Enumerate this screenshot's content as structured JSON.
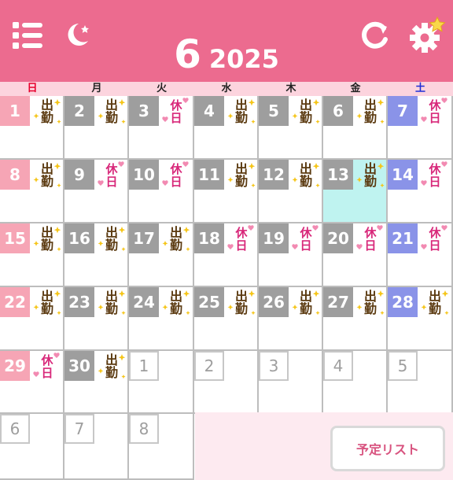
{
  "header": {
    "month": "6",
    "year": "2025",
    "icons": [
      "menu-icon",
      "moon-icon",
      "reload-icon",
      "gear-icon"
    ],
    "background": "#ec6b8f"
  },
  "weekdays": [
    "日",
    "月",
    "火",
    "水",
    "木",
    "金",
    "土"
  ],
  "weekday_colors": [
    "#e6002d",
    "#222222",
    "#222222",
    "#222222",
    "#222222",
    "#222222",
    "#1f2fd6"
  ],
  "stamps": {
    "work": "出勤",
    "off": "休日"
  },
  "weeks": [
    [
      {
        "d": "1",
        "s": "work"
      },
      {
        "d": "2",
        "s": "work"
      },
      {
        "d": "3",
        "s": "off"
      },
      {
        "d": "4",
        "s": "work"
      },
      {
        "d": "5",
        "s": "work"
      },
      {
        "d": "6",
        "s": "work"
      },
      {
        "d": "7",
        "s": "off"
      }
    ],
    [
      {
        "d": "8",
        "s": "work"
      },
      {
        "d": "9",
        "s": "off"
      },
      {
        "d": "10",
        "s": "off"
      },
      {
        "d": "11",
        "s": "work"
      },
      {
        "d": "12",
        "s": "work"
      },
      {
        "d": "13",
        "s": "work",
        "today": true
      },
      {
        "d": "14",
        "s": "off"
      }
    ],
    [
      {
        "d": "15",
        "s": "work"
      },
      {
        "d": "16",
        "s": "work"
      },
      {
        "d": "17",
        "s": "work"
      },
      {
        "d": "18",
        "s": "off"
      },
      {
        "d": "19",
        "s": "off"
      },
      {
        "d": "20",
        "s": "off"
      },
      {
        "d": "21",
        "s": "off"
      }
    ],
    [
      {
        "d": "22",
        "s": "work"
      },
      {
        "d": "23",
        "s": "work"
      },
      {
        "d": "24",
        "s": "work"
      },
      {
        "d": "25",
        "s": "work"
      },
      {
        "d": "26",
        "s": "work"
      },
      {
        "d": "27",
        "s": "work"
      },
      {
        "d": "28",
        "s": "work"
      }
    ],
    [
      {
        "d": "29",
        "s": "off"
      },
      {
        "d": "30",
        "s": "work"
      },
      {
        "d": "1",
        "other": true
      },
      {
        "d": "2",
        "other": true
      },
      {
        "d": "3",
        "other": true
      },
      {
        "d": "4",
        "other": true
      },
      {
        "d": "5",
        "other": true
      }
    ],
    [
      {
        "d": "6",
        "other": true
      },
      {
        "d": "7",
        "other": true
      },
      {
        "d": "8",
        "other": true
      }
    ]
  ],
  "schedule_button": "予定リスト",
  "today_color": "#bff3f0"
}
